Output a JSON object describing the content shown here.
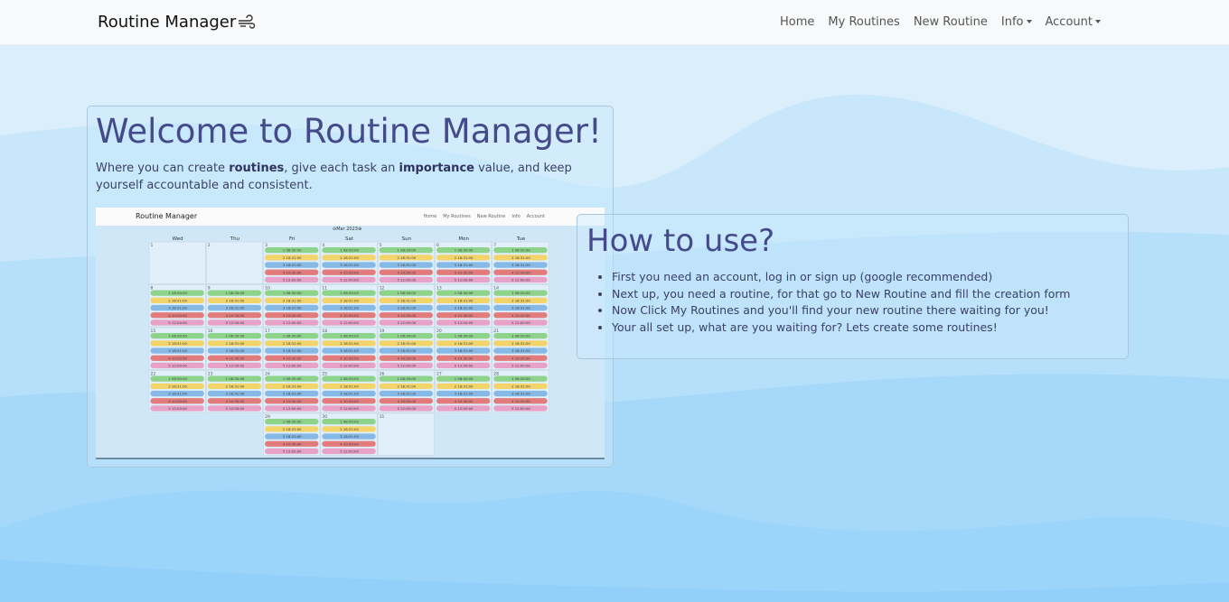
{
  "navbar": {
    "brand": "Routine Manager",
    "brand_icon": "wind-icon",
    "links": [
      {
        "label": "Home"
      },
      {
        "label": "My Routines"
      },
      {
        "label": "New Routine"
      },
      {
        "label": "Info",
        "dropdown": true
      },
      {
        "label": "Account",
        "dropdown": true
      }
    ]
  },
  "welcome": {
    "title": "Welcome to Routine Manager!",
    "intro_1": "Where you can create ",
    "intro_bold_1": "routines",
    "intro_2": ", give each task an ",
    "intro_bold_2": "importance",
    "intro_3": " value, and keep yourself accountable and consistent."
  },
  "preview": {
    "brand": "Routine Manager",
    "links": [
      "Home",
      "My Routines",
      "New Routine",
      "Info",
      "Account"
    ],
    "month": "Mar 2023",
    "weekdays": [
      "Wed",
      "Thu",
      "Fri",
      "Sat",
      "Sun",
      "Mon",
      "Tue"
    ],
    "task_labels": [
      "1 08:30:00",
      "2 18:31:00",
      "3 18:31:00",
      "4 10:30:00",
      "5 12:00:00"
    ],
    "task_colors": [
      "#8dd38a",
      "#f2d46a",
      "#86b9e6",
      "#e27c7c",
      "#e8a2c8"
    ]
  },
  "how_to": {
    "title": "How to use?",
    "steps": [
      "First you need an account, log in or sign up (google recommended)",
      "Next up, you need a routine, for that go to New Routine and fill the creation form",
      "Now Click My Routines and you'll find your new routine there waiting for you!",
      "Your all set up, what are you waiting for? Lets create some routines!"
    ]
  },
  "colors": {
    "heading": "#454a8a",
    "background_top": "#daeefb",
    "background_bottom": "#8ecff8"
  }
}
